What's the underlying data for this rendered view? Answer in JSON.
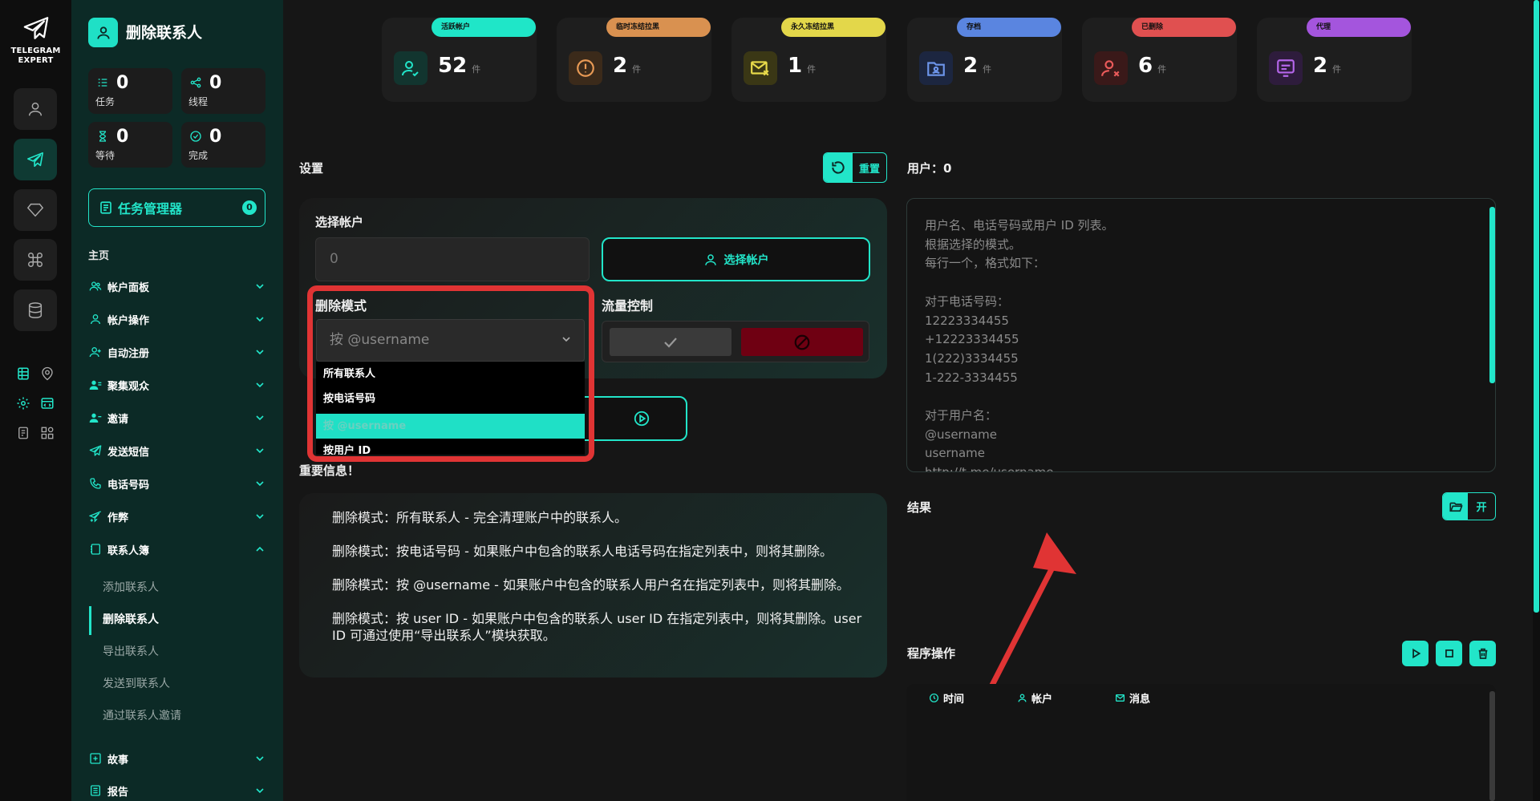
{
  "app": {
    "logo_line1": "TELEGRAM",
    "logo_line2": "EXPERT"
  },
  "page": {
    "title": "删除联系人"
  },
  "mini_stats": [
    {
      "value": "0",
      "label": "任务"
    },
    {
      "value": "0",
      "label": "线程"
    },
    {
      "value": "0",
      "label": "等待"
    },
    {
      "value": "0",
      "label": "完成"
    }
  ],
  "task_manager": {
    "label": "任务管理器",
    "count": "0"
  },
  "menu": {
    "home": "主页",
    "items": [
      "帐户面板",
      "帐户操作",
      "自动注册",
      "聚集观众",
      "邀请",
      "发送短信",
      "电话号码",
      "作弊",
      "联系人簿"
    ],
    "sub_items": [
      "添加联系人",
      "删除联系人",
      "导出联系人",
      "发送到联系人",
      "通过联系人邀请"
    ],
    "bottom_items": [
      "故事",
      "报告"
    ]
  },
  "stats": [
    {
      "tag": "活跃帐户",
      "value": "52",
      "unit": "件",
      "color": "#1fe6c8"
    },
    {
      "tag": "临时冻结拉黑",
      "value": "2",
      "unit": "件",
      "color": "#d99150"
    },
    {
      "tag": "永久冻结拉黑",
      "value": "1",
      "unit": "件",
      "color": "#e3d74a"
    },
    {
      "tag": "存档",
      "value": "2",
      "unit": "件",
      "color": "#5a85e0"
    },
    {
      "tag": "已删除",
      "value": "6",
      "unit": "件",
      "color": "#e05050"
    },
    {
      "tag": "代理",
      "value": "2",
      "unit": "件",
      "color": "#a455dd"
    }
  ],
  "settings": {
    "label": "设置",
    "reset": "重置",
    "select_account_label": "选择帐户",
    "account_input_value": "0",
    "select_account_button": "选择帐户",
    "delete_mode_label": "删除模式",
    "delete_mode_selected": "按 @username",
    "delete_mode_options": [
      "所有联系人",
      "按电话号码",
      "按 @username",
      "按用户 ID"
    ],
    "flow_control_label": "流量控制"
  },
  "info": {
    "label": "重要信息！",
    "lines": [
      "删除模式：所有联系人 - 完全清理账户中的联系人。",
      "删除模式：按电话号码 - 如果账户中包含的联系人电话号码在指定列表中，则将其删除。",
      "删除模式：按 @username - 如果账户中包含的联系人用户名在指定列表中，则将其删除。",
      "删除模式：按 user ID - 如果账户中包含的联系人 user ID 在指定列表中，则将其删除。user ID 可通过使用“导出联系人”模块获取。"
    ]
  },
  "users": {
    "label": "用户：0",
    "placeholder": "用户名、电话号码或用户 ID 列表。\n根据选择的模式。\n每行一个，格式如下：\n\n对于电话号码：\n12223334455\n+12223334455\n1(222)3334455\n1-222-3334455\n\n对于用户名：\n@username\nusername\nhttp://t.me/username"
  },
  "results": {
    "label": "结果",
    "open": "开"
  },
  "program": {
    "label": "程序操作",
    "col_time": "时间",
    "col_account": "帐户",
    "col_message": "消息"
  },
  "colors": {
    "accent": "#22e5c9",
    "highlight": "#e03434"
  }
}
